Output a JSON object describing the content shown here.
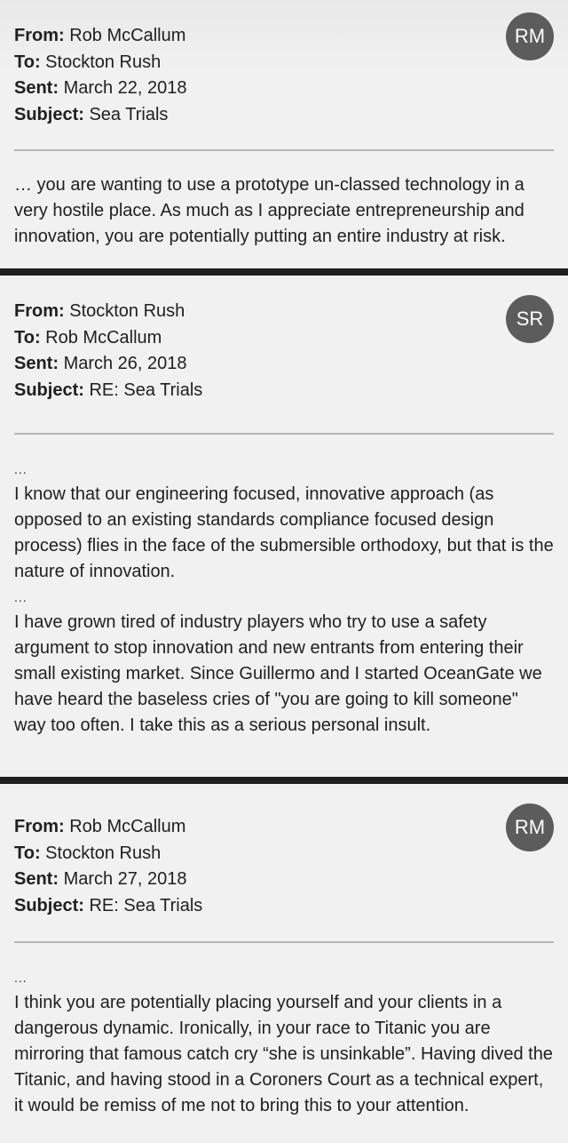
{
  "emails": [
    {
      "avatar_initials": "RM",
      "from_label": "From:",
      "from": "Rob McCallum",
      "to_label": "To:",
      "to": "Stockton Rush",
      "sent_label": "Sent:",
      "sent": "March 22, 2018",
      "subject_label": "Subject:",
      "subject": "Sea Trials",
      "paragraphs": [
        "… you are wanting to use a prototype un-classed technology in a very hostile place. As much as I appreciate entrepreneurship and innovation, you are potentially putting an entire industry at risk."
      ]
    },
    {
      "avatar_initials": "SR",
      "from_label": "From:",
      "from": "Stockton Rush",
      "to_label": "To:",
      "to": "Rob McCallum",
      "sent_label": "Sent:",
      "sent": "March 26, 2018",
      "subject_label": "Subject:",
      "subject": "RE: Sea Trials",
      "ellipsis": "...",
      "paragraphs": [
        "I know that our engineering focused, innovative approach (as opposed to an existing standards compliance focused design process) flies in the face of the submersible orthodoxy, but that is the nature of innovation.",
        "I have grown tired of industry players who try to use a safety argument to stop innovation and new entrants from entering their small existing market. Since Guillermo and I started OceanGate we have heard the baseless cries of \"you are going to kill someone\" way too often. I take this as a serious personal insult."
      ]
    },
    {
      "avatar_initials": "RM",
      "from_label": "From:",
      "from": "Rob McCallum",
      "to_label": "To:",
      "to": "Stockton Rush",
      "sent_label": "Sent:",
      "sent": "March 27, 2018",
      "subject_label": "Subject:",
      "subject": "RE: Sea Trials",
      "ellipsis": "...",
      "paragraphs": [
        "I think you are potentially placing yourself and your clients in a dangerous dynamic. Ironically, in your race to Titanic you are mirroring that famous catch cry “she is unsinkable”. Having dived the Titanic, and having stood in a Coroners Court as a technical expert, it would be remiss of me not to bring this to your attention."
      ]
    }
  ],
  "colors": {
    "background": "#f1f1f1",
    "avatar_bg": "#5c5c5c",
    "separator": "#1f1f1f",
    "rule": "#b5b5b5",
    "text": "#202020"
  }
}
